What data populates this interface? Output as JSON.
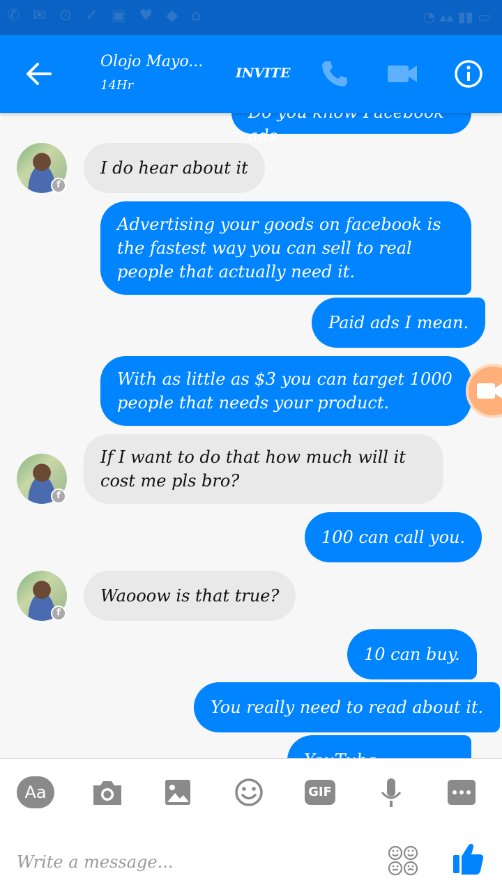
{
  "header": {
    "title": "Olojo Mayo...",
    "subtitle": "14Hr",
    "invite_label": "INVITE"
  },
  "messages": [
    {
      "side": "out",
      "text": "Do you know Facebook ads."
    },
    {
      "side": "in",
      "text": "I do hear about it"
    },
    {
      "side": "out",
      "text": "Advertising your goods on facebook is the fastest way you can sell to real people that actually need it."
    },
    {
      "side": "out",
      "text": "Paid ads I mean."
    },
    {
      "side": "out",
      "text": "With as little as $3 you can target 1000 people that needs your product."
    },
    {
      "side": "in",
      "text": "If I want to do that how much will it cost me pls bro?"
    },
    {
      "side": "out",
      "text": "100 can call you."
    },
    {
      "side": "in",
      "text": "Waooow is that true?"
    },
    {
      "side": "out",
      "text": "10 can buy."
    },
    {
      "side": "out",
      "text": "You really need to read about it."
    },
    {
      "side": "out",
      "text": "YouTube especially"
    }
  ],
  "composer": {
    "placeholder": "Write a message...",
    "aa_label": "Aa",
    "gif_label": "GIF"
  },
  "colors": {
    "header_blue": "#0084ff",
    "status_blue": "#0a63c4",
    "incoming_bubble": "#e9e9e9",
    "tool_gray": "#8a8a8a"
  },
  "icons": [
    "back-arrow-icon",
    "phone-icon",
    "video-camera-icon",
    "info-icon",
    "camera-icon",
    "image-icon",
    "emoji-icon",
    "microphone-icon",
    "more-icon",
    "stickers-icon",
    "thumbs-up-icon"
  ]
}
